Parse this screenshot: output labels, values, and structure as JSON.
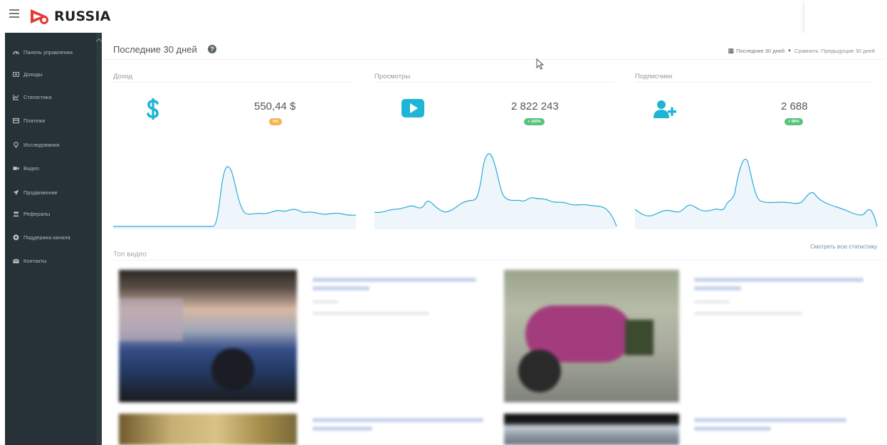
{
  "brand": {
    "name": "RUSSIA",
    "accent": "#e53935"
  },
  "sidebar": {
    "items": [
      {
        "label": "Панель управления",
        "icon": "dashboard-icon"
      },
      {
        "label": "Доходы",
        "icon": "money-icon"
      },
      {
        "label": "Статистика",
        "icon": "chart-line-icon"
      },
      {
        "label": "Платежи",
        "icon": "credit-card-icon"
      },
      {
        "label": "Исследования",
        "icon": "lightbulb-icon"
      },
      {
        "label": "Видео",
        "icon": "video-camera-icon"
      },
      {
        "label": "Продвижение",
        "icon": "paper-plane-icon"
      },
      {
        "label": "Рефералы",
        "icon": "users-icon"
      },
      {
        "label": "Поддержка канала",
        "icon": "support-icon"
      },
      {
        "label": "Контакты",
        "icon": "envelope-icon"
      }
    ]
  },
  "header": {
    "title": "Последние 30 дней",
    "period_label": "Последние 30 дней",
    "compare_label": "Сравнить: Предыдущие 30 дней"
  },
  "stats": [
    {
      "label": "Доход",
      "value": "550,44 $",
      "badge": "0%",
      "badge_color": "#f6b44b",
      "icon": "dollar-icon",
      "color": "#1fb5d4"
    },
    {
      "label": "Просмотры",
      "value": "2 822 243",
      "badge": "+ 165%",
      "badge_color": "#58c27f",
      "icon": "play-icon",
      "color": "#1fb5d4"
    },
    {
      "label": "Подписчики",
      "value": "2 688",
      "badge": "+ 98%",
      "badge_color": "#58c27f",
      "icon": "add-user-icon",
      "color": "#1fb5d4"
    }
  ],
  "top_videos": {
    "title": "Топ видео",
    "all_stats_link": "Смотреть всю статистику"
  }
}
